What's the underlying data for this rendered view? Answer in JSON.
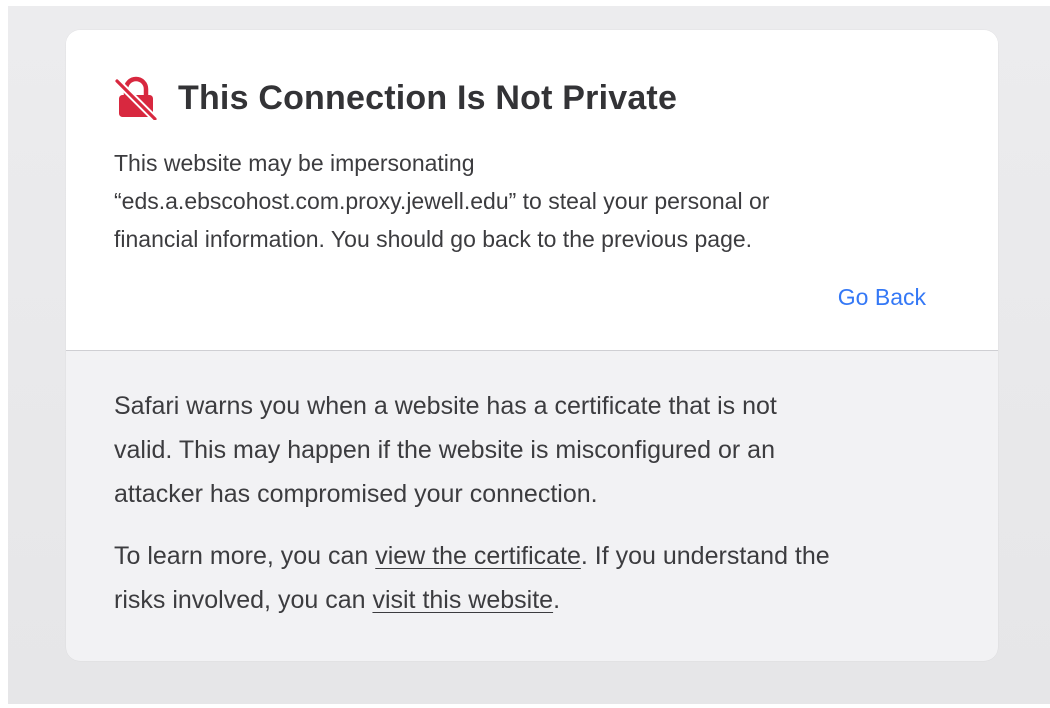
{
  "warning": {
    "icon": "broken-lock-icon",
    "icon_color": "#d8283f",
    "title": "This Connection Is Not Private",
    "desc_line1": "This website may be impersonating",
    "desc_line2": "“eds.a.ebscohost.com.proxy.jewell.edu” to steal your personal or",
    "desc_line3": "financial information. You should go back to the previous page.",
    "go_back_label": "Go Back",
    "accent_color": "#3478f6"
  },
  "details": {
    "para1_line1": "Safari warns you when a website has a certificate that is not",
    "para1_line2": "valid. This may happen if the website is misconfigured or an",
    "para1_line3": "attacker has compromised your connection.",
    "para2_prefix": "To learn more, you can ",
    "view_certificate_link": "view the certificate",
    "para2_middle": ". If you understand the",
    "para2_prefix2": "risks involved, you can ",
    "visit_website_link": "visit this website",
    "para2_suffix": "."
  }
}
